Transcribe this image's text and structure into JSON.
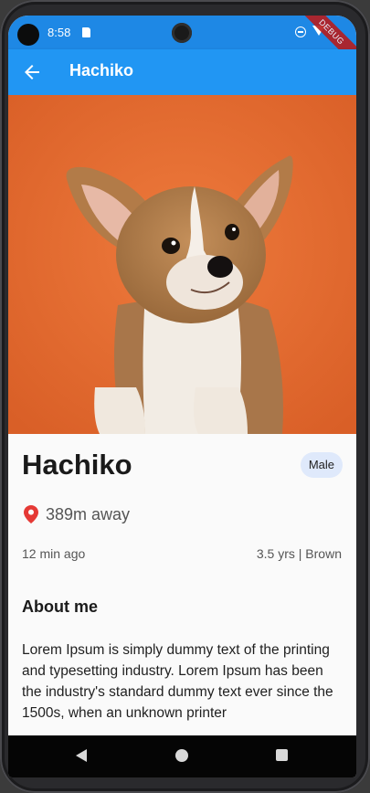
{
  "status_bar": {
    "time": "8:58",
    "icons": [
      "sim-card-icon",
      "do-not-disturb-icon",
      "wifi-icon",
      "battery-icon"
    ],
    "debug_banner": "DEBUG"
  },
  "app_bar": {
    "back_icon": "arrow-back-icon",
    "title": "Hachiko"
  },
  "hero_image": {
    "subject": "corgi puppy on orange background",
    "background_color": "#e66a2e"
  },
  "pet": {
    "name": "Hachiko",
    "gender": "Male",
    "distance": "389m away",
    "posted": "12 min ago",
    "age_color": "3.5 yrs | Brown"
  },
  "about": {
    "heading": "About me",
    "text": "Lorem Ipsum is simply dummy text of the printing and typesetting industry. Lorem Ipsum has been the industry's standard dummy text ever since the 1500s, when an unknown printer"
  },
  "colors": {
    "app_bar": "#2196f3",
    "status_bar": "#1e88e5",
    "badge_bg": "#dfe9fb",
    "pin": "#e53935"
  },
  "nav_bar": {
    "icons": [
      "nav-back-icon",
      "nav-home-icon",
      "nav-recents-icon"
    ]
  }
}
